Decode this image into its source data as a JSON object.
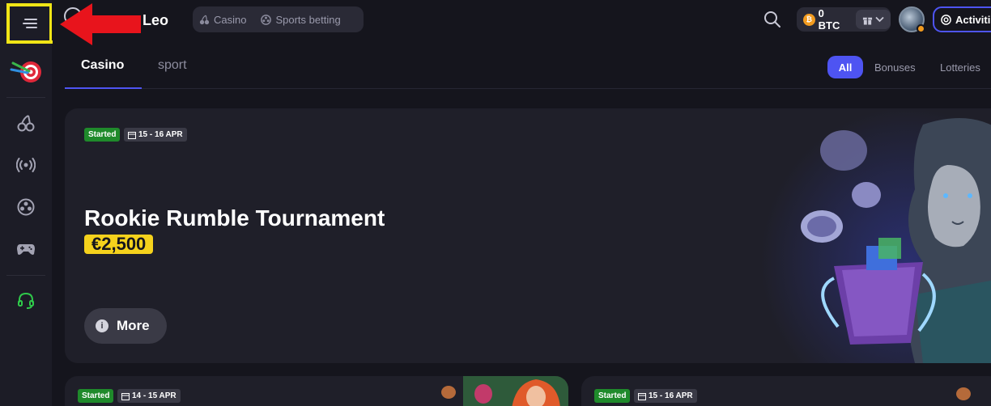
{
  "header": {
    "brand": "Leo",
    "nav": [
      {
        "label": "Casino",
        "icon": "cherry-icon"
      },
      {
        "label": "Sports betting",
        "icon": "soccer-ball-icon"
      }
    ],
    "balance": "0 BTC",
    "activities_label": "Activiti"
  },
  "tabs": [
    {
      "label": "Casino",
      "active": true
    },
    {
      "label": "sport",
      "active": false
    }
  ],
  "filters": [
    {
      "label": "All",
      "active": true
    },
    {
      "label": "Bonuses",
      "active": false
    },
    {
      "label": "Lotteries",
      "active": false
    }
  ],
  "hero": {
    "status": "Started",
    "dates": "15 - 16 APR",
    "title": "Rookie Rumble Tournament",
    "prize": "€2,500",
    "more_label": "More"
  },
  "cards": [
    {
      "status": "Started",
      "dates": "14 - 15 APR"
    },
    {
      "status": "Started",
      "dates": "15 - 16 APR"
    }
  ],
  "sidebar_icons": [
    "dartboard-icon",
    "cherry-icon",
    "live-broadcast-icon",
    "soccer-ball-icon",
    "gamepad-icon",
    "headset-icon"
  ],
  "colors": {
    "accent": "#4e54f2",
    "highlight_box": "#f1e516",
    "annotation_arrow": "#e8141c",
    "started_tag": "#1f8a2b",
    "prize_tag": "#f5d21c",
    "support_icon": "#2fc84a"
  }
}
